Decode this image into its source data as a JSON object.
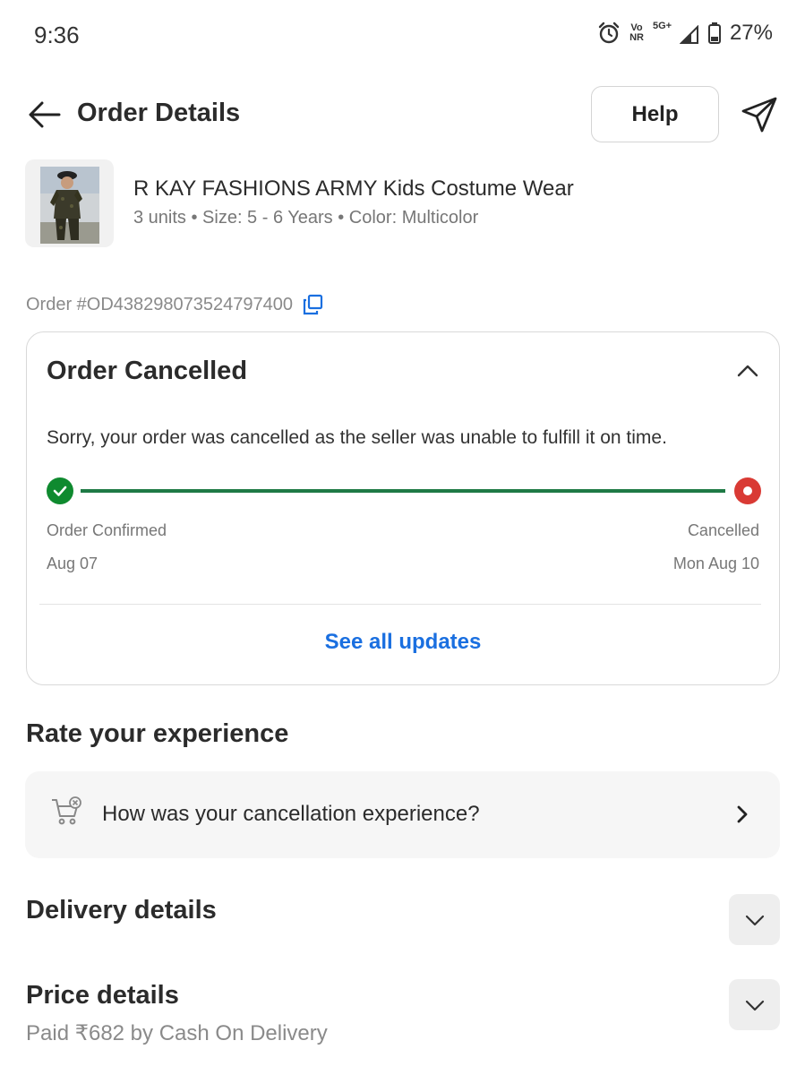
{
  "status_bar": {
    "time": "9:36",
    "alarm_icon": "alarm-icon",
    "volte_label_top": "Vo",
    "volte_label_bottom": "NR",
    "network_label": "5G+",
    "battery": "27%"
  },
  "header": {
    "title": "Order Details",
    "help_label": "Help",
    "back_icon": "arrow-left-icon",
    "share_icon": "share-send-icon"
  },
  "product": {
    "name": "R KAY FASHIONS ARMY Kids Costume Wear",
    "meta": "3 units • Size: 5 - 6 Years • Color: Multicolor"
  },
  "order": {
    "id_text": "Order #OD438298073524797400"
  },
  "status_card": {
    "title": "Order Cancelled",
    "message": "Sorry, your order was cancelled as the seller was unable to fulfill it on time.",
    "steps": [
      {
        "label": "Order Confirmed",
        "date": "Aug 07",
        "state": "done"
      },
      {
        "label": "Cancelled",
        "date": "Mon Aug 10",
        "state": "cancelled"
      }
    ],
    "see_all_label": "See all updates"
  },
  "rate": {
    "heading": "Rate your experience",
    "prompt": "How was your cancellation experience?"
  },
  "delivery": {
    "heading": "Delivery details"
  },
  "price": {
    "heading": "Price details",
    "summary": "Paid ₹682 by Cash On Delivery"
  },
  "colors": {
    "accent_blue": "#1a6fe0",
    "success_green": "#0f8a2f",
    "cancel_red": "#d93a34"
  }
}
